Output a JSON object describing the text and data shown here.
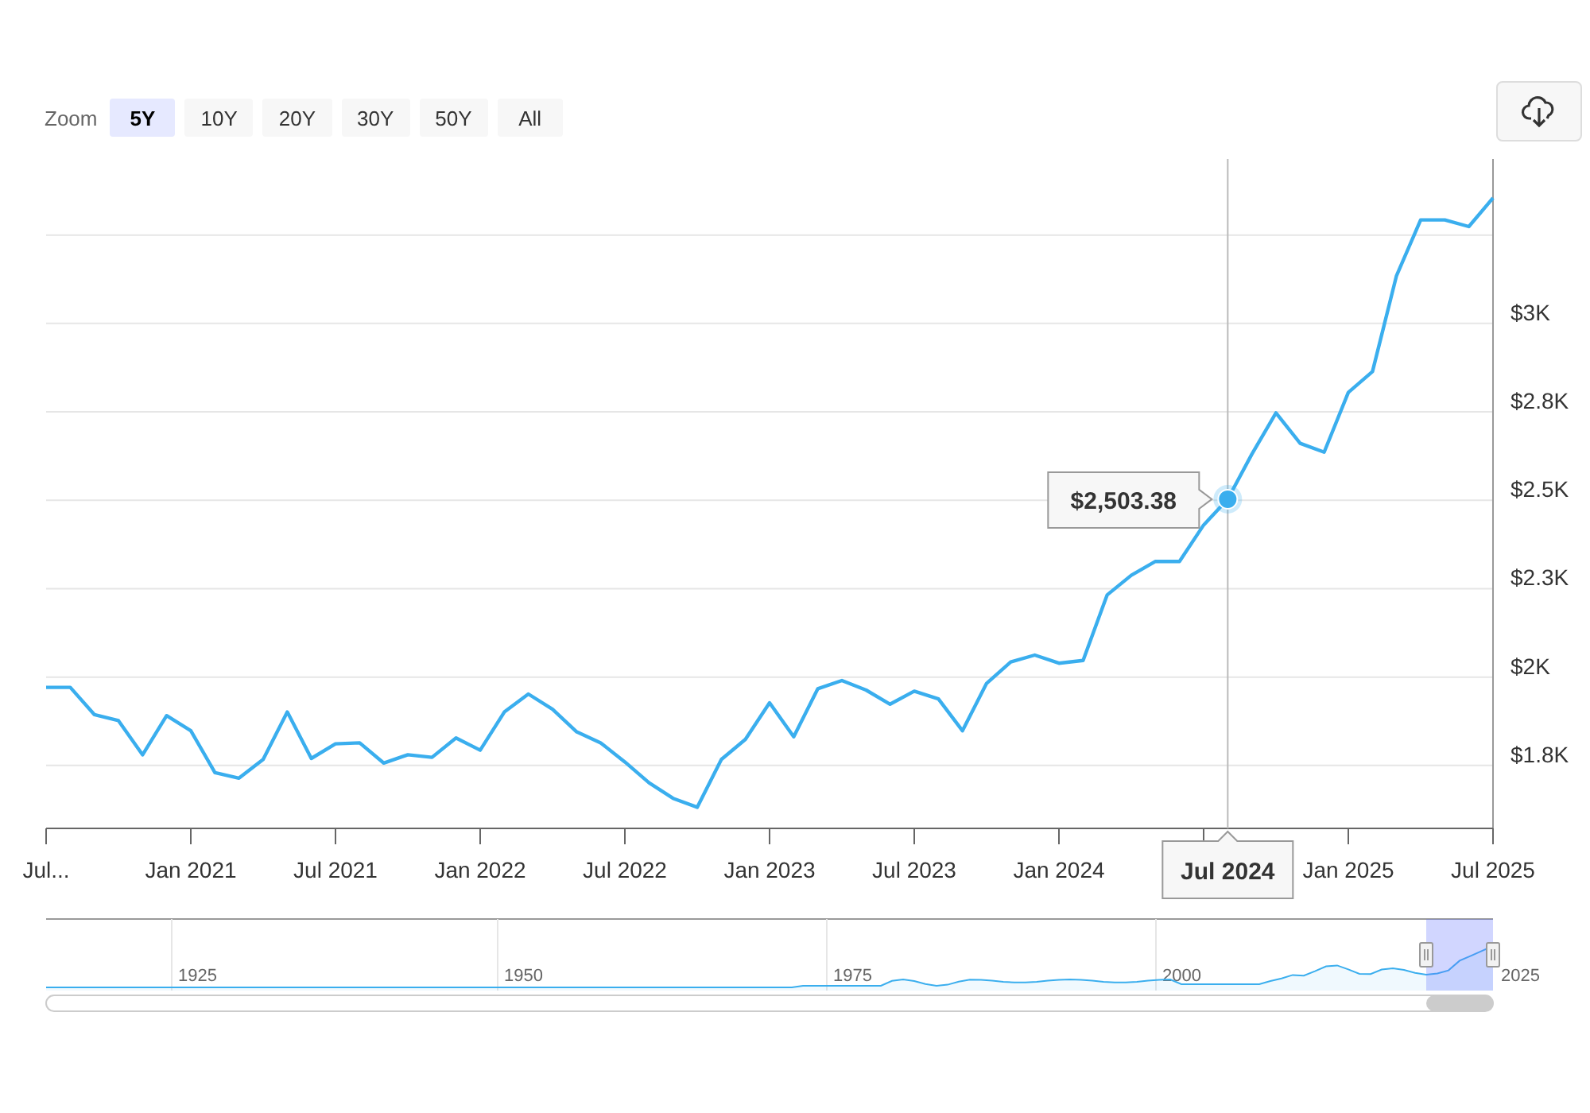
{
  "zoom": {
    "label": "Zoom",
    "buttons": [
      {
        "label": "5Y",
        "selected": true
      },
      {
        "label": "10Y",
        "selected": false
      },
      {
        "label": "20Y",
        "selected": false
      },
      {
        "label": "30Y",
        "selected": false
      },
      {
        "label": "50Y",
        "selected": false
      },
      {
        "label": "All",
        "selected": false
      }
    ]
  },
  "chart": {
    "chart_data": {
      "type": "line",
      "grid": true,
      "ylim": [
        1572,
        3465
      ],
      "categories": [
        "Jul...",
        null,
        null,
        null,
        null,
        null,
        "Jan 2021",
        null,
        null,
        null,
        null,
        null,
        "Jul 2021",
        null,
        null,
        null,
        null,
        null,
        "Jan 2022",
        null,
        null,
        null,
        null,
        null,
        "Jul 2022",
        null,
        null,
        null,
        null,
        null,
        "Jan 2023",
        null,
        null,
        null,
        null,
        null,
        "Jul 2023",
        null,
        null,
        null,
        null,
        null,
        "Jan 2024",
        null,
        null,
        null,
        null,
        null,
        null,
        "Jul 2024",
        null,
        null,
        null,
        null,
        "Jan 2025",
        null,
        null,
        null,
        null,
        null,
        "Jul 2025"
      ],
      "yticks": [
        {
          "value": 1750,
          "label": "$1.8K"
        },
        {
          "value": 2000,
          "label": "$2K"
        },
        {
          "value": 2250,
          "label": "$2.3K"
        },
        {
          "value": 2500,
          "label": "$2.5K"
        },
        {
          "value": 2750,
          "label": "$2.8K"
        },
        {
          "value": 3000,
          "label": "$3K"
        }
      ],
      "series": [
        {
          "color": "#3aaeee",
          "values": [
            1971,
            1971,
            1894,
            1877,
            1780,
            1891,
            1848,
            1730,
            1714,
            1767,
            1901,
            1770,
            1811,
            1814,
            1757,
            1780,
            1773,
            1828,
            1793,
            1901,
            1952,
            1909,
            1845,
            1814,
            1760,
            1701,
            1657,
            1632,
            1767,
            1824,
            1927,
            1831,
            1967,
            1990,
            1963,
            1923,
            1960,
            1938,
            1848,
            1982,
            2043,
            2062,
            2039,
            2047,
            2232,
            2288,
            2327,
            2327,
            2430,
            2503,
            2630,
            2747,
            2661,
            2636,
            2805,
            2864,
            3135,
            3293,
            3293,
            3274,
            3355
          ]
        }
      ],
      "annotations": [
        {
          "x": "Jul 2024",
          "text": "$2,503.38"
        }
      ]
    }
  },
  "navigator": {
    "labels": [
      "1925",
      "1950",
      "1975",
      "2000",
      "2025"
    ]
  }
}
